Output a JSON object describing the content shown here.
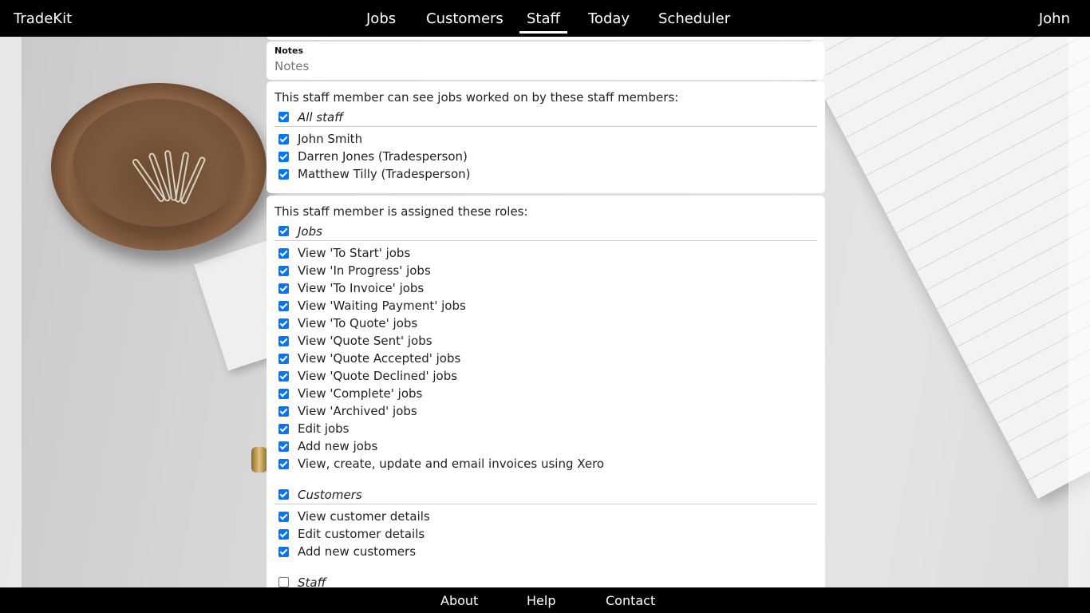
{
  "app": {
    "brand": "TradeKit",
    "user": "John"
  },
  "nav": {
    "items": [
      {
        "label": "Jobs",
        "active": false
      },
      {
        "label": "Customers",
        "active": false
      },
      {
        "label": "Staff",
        "active": true
      },
      {
        "label": "Today",
        "active": false
      },
      {
        "label": "Scheduler",
        "active": false
      }
    ]
  },
  "notes": {
    "label": "Notes",
    "placeholder": "Notes",
    "value": ""
  },
  "visibility": {
    "title": "This staff member can see jobs worked on by these staff members:",
    "all_label": "All staff",
    "all_checked": true,
    "members": [
      {
        "label": "John Smith",
        "checked": true
      },
      {
        "label": "Darren Jones (Tradesperson)",
        "checked": true
      },
      {
        "label": "Matthew Tilly (Tradesperson)",
        "checked": true
      }
    ]
  },
  "roles": {
    "title": "This staff member is assigned these roles:",
    "groups": [
      {
        "label": "Jobs",
        "checked": true,
        "items": [
          {
            "label": "View 'To Start' jobs",
            "checked": true
          },
          {
            "label": "View 'In Progress' jobs",
            "checked": true
          },
          {
            "label": "View 'To Invoice' jobs",
            "checked": true
          },
          {
            "label": "View 'Waiting Payment' jobs",
            "checked": true
          },
          {
            "label": "View 'To Quote' jobs",
            "checked": true
          },
          {
            "label": "View 'Quote Sent' jobs",
            "checked": true
          },
          {
            "label": "View 'Quote Accepted' jobs",
            "checked": true
          },
          {
            "label": "View 'Quote Declined' jobs",
            "checked": true
          },
          {
            "label": "View 'Complete' jobs",
            "checked": true
          },
          {
            "label": "View 'Archived' jobs",
            "checked": true
          },
          {
            "label": "Edit jobs",
            "checked": true
          },
          {
            "label": "Add new jobs",
            "checked": true
          },
          {
            "label": "View, create, update and email invoices using Xero",
            "checked": true
          }
        ]
      },
      {
        "label": "Customers",
        "checked": true,
        "items": [
          {
            "label": "View customer details",
            "checked": true
          },
          {
            "label": "Edit customer details",
            "checked": true
          },
          {
            "label": "Add new customers",
            "checked": true
          }
        ]
      },
      {
        "label": "Staff",
        "checked": false,
        "items": []
      }
    ]
  },
  "footer": {
    "links": [
      "About",
      "Help",
      "Contact"
    ]
  },
  "colors": {
    "navbar": "#000000",
    "checkbox": "#0075ff",
    "card": "#ffffff"
  }
}
